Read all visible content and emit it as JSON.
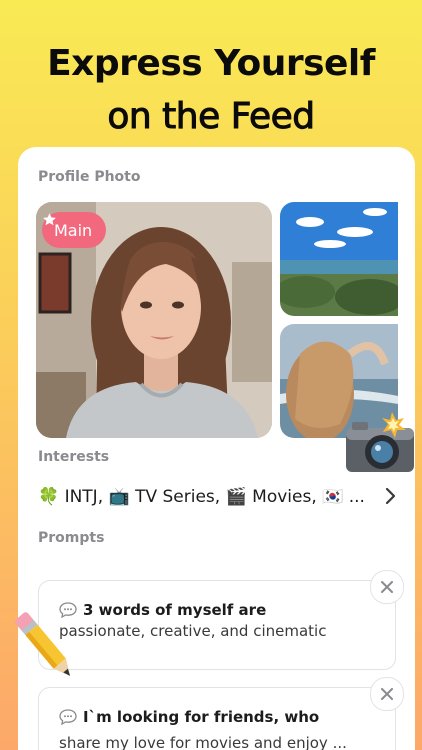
{
  "headline": {
    "line1": "Express Yourself",
    "line2": "on the Feed"
  },
  "profile": {
    "section_label": "Profile Photo",
    "main_badge": "Main"
  },
  "interests": {
    "section_label": "Interests",
    "text": "🍀 INTJ, 📺 TV Series, 🎬 Movies, 🇰🇷 ..."
  },
  "prompts": {
    "section_label": "Prompts",
    "items": [
      {
        "title": "3 words of myself are",
        "answer": "passionate, creative, and cinematic"
      },
      {
        "title": "I`m looking for friends, who",
        "answer": "share my love for movies and enjoy ..."
      }
    ]
  },
  "colors": {
    "accent_badge": "#f2697e",
    "bg_top": "#f9ea54",
    "bg_bottom": "#fca86a"
  },
  "icons": [
    "star-icon",
    "chevron-right-icon",
    "speech-bubble-icon",
    "close-icon",
    "camera-icon",
    "pencil-icon"
  ]
}
